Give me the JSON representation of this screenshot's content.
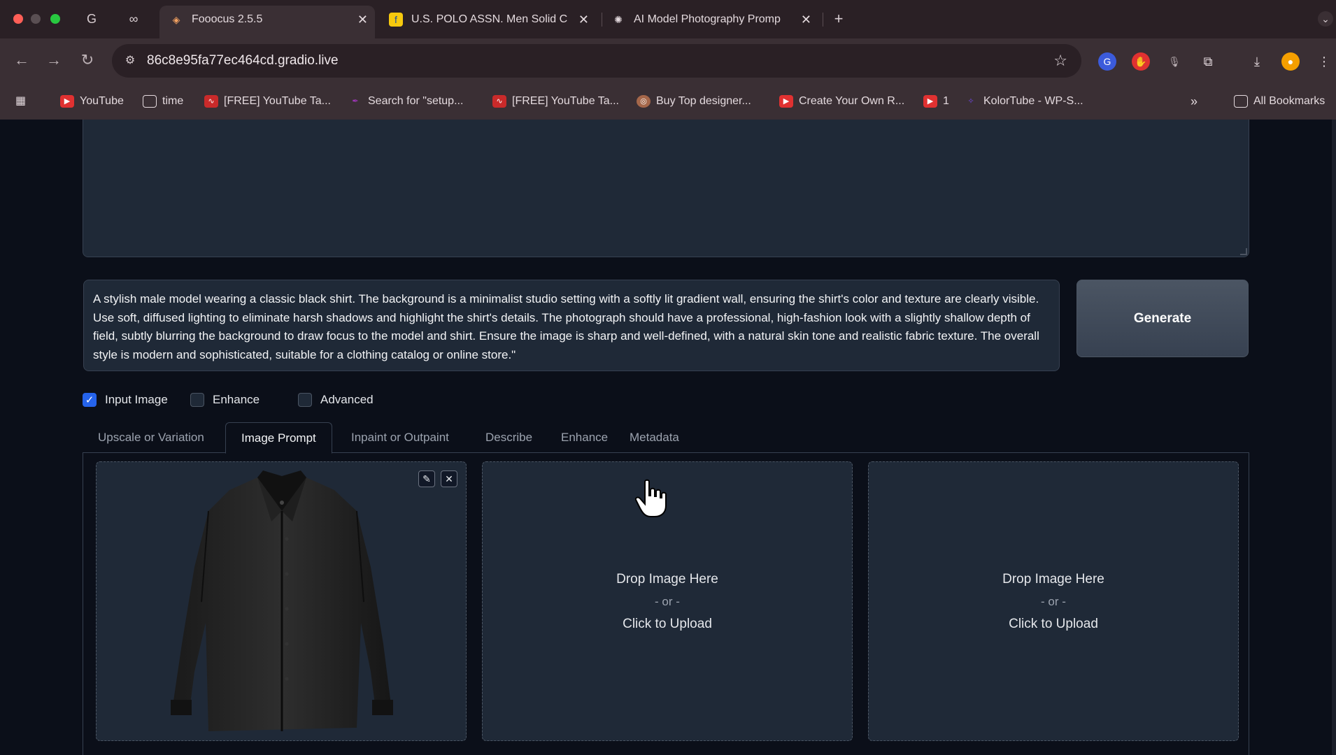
{
  "browser": {
    "tabs": [
      {
        "title": "Fooocus 2.5.5",
        "active": true
      },
      {
        "title": "U.S. POLO ASSN. Men Solid C",
        "active": false
      },
      {
        "title": "AI Model Photography Promp",
        "active": false
      }
    ],
    "new_tab_icon": "plus-icon",
    "url": "86c8e95fa77ec464cd.gradio.live",
    "bookmarks": [
      {
        "label": "YouTube",
        "icon": "youtube-icon"
      },
      {
        "label": "time",
        "icon": "folder-icon"
      },
      {
        "label": "[FREE] YouTube Ta...",
        "icon": "wave-icon"
      },
      {
        "label": "Search for \"setup...",
        "icon": "pen-icon"
      },
      {
        "label": "[FREE] YouTube Ta...",
        "icon": "wave-icon"
      },
      {
        "label": "Buy Top designer...",
        "icon": "globe-icon"
      },
      {
        "label": "Create Your Own R...",
        "icon": "youtube-icon"
      },
      {
        "label": "1",
        "icon": "youtube-icon"
      },
      {
        "label": "KolorTube - WP-S...",
        "icon": "kolortube-icon"
      }
    ],
    "overflow_label": "»",
    "all_bookmarks_label": "All Bookmarks",
    "colors": {
      "tabbar": "#2a2025",
      "toolbar": "#3a2f34"
    }
  },
  "app": {
    "prompt_text": "A stylish male model wearing a classic black shirt. The background is a minimalist studio setting with a softly lit gradient wall, ensuring the shirt's color and texture are clearly visible. Use soft, diffused lighting to eliminate harsh shadows and highlight the shirt's details. The photograph should have a professional, high-fashion look with a slightly shallow depth of field, subtly blurring the background to draw focus to the model and shirt. Ensure the image is sharp and well-defined, with a natural skin tone and realistic fabric texture. The overall style is modern and sophisticated, suitable for a clothing catalog or online store.\"",
    "generate_label": "Generate",
    "checkboxes": [
      {
        "label": "Input Image",
        "checked": true
      },
      {
        "label": "Enhance",
        "checked": false
      },
      {
        "label": "Advanced",
        "checked": false
      }
    ],
    "tabs": [
      {
        "label": "Upscale or Variation",
        "active": false
      },
      {
        "label": "Image Prompt",
        "active": true
      },
      {
        "label": "Inpaint or Outpaint",
        "active": false
      },
      {
        "label": "Describe",
        "active": false
      },
      {
        "label": "Enhance",
        "active": false
      },
      {
        "label": "Metadata",
        "active": false
      }
    ],
    "upload": {
      "drop_label": "Drop Image Here",
      "or_label": "- or -",
      "click_label": "Click to Upload"
    },
    "image_tools": {
      "edit_icon": "pencil-icon",
      "clear_icon": "close-icon"
    },
    "colors": {
      "bg": "#0b0f19",
      "surface": "#1f2937",
      "border": "#374151",
      "accent": "#2563eb"
    }
  }
}
